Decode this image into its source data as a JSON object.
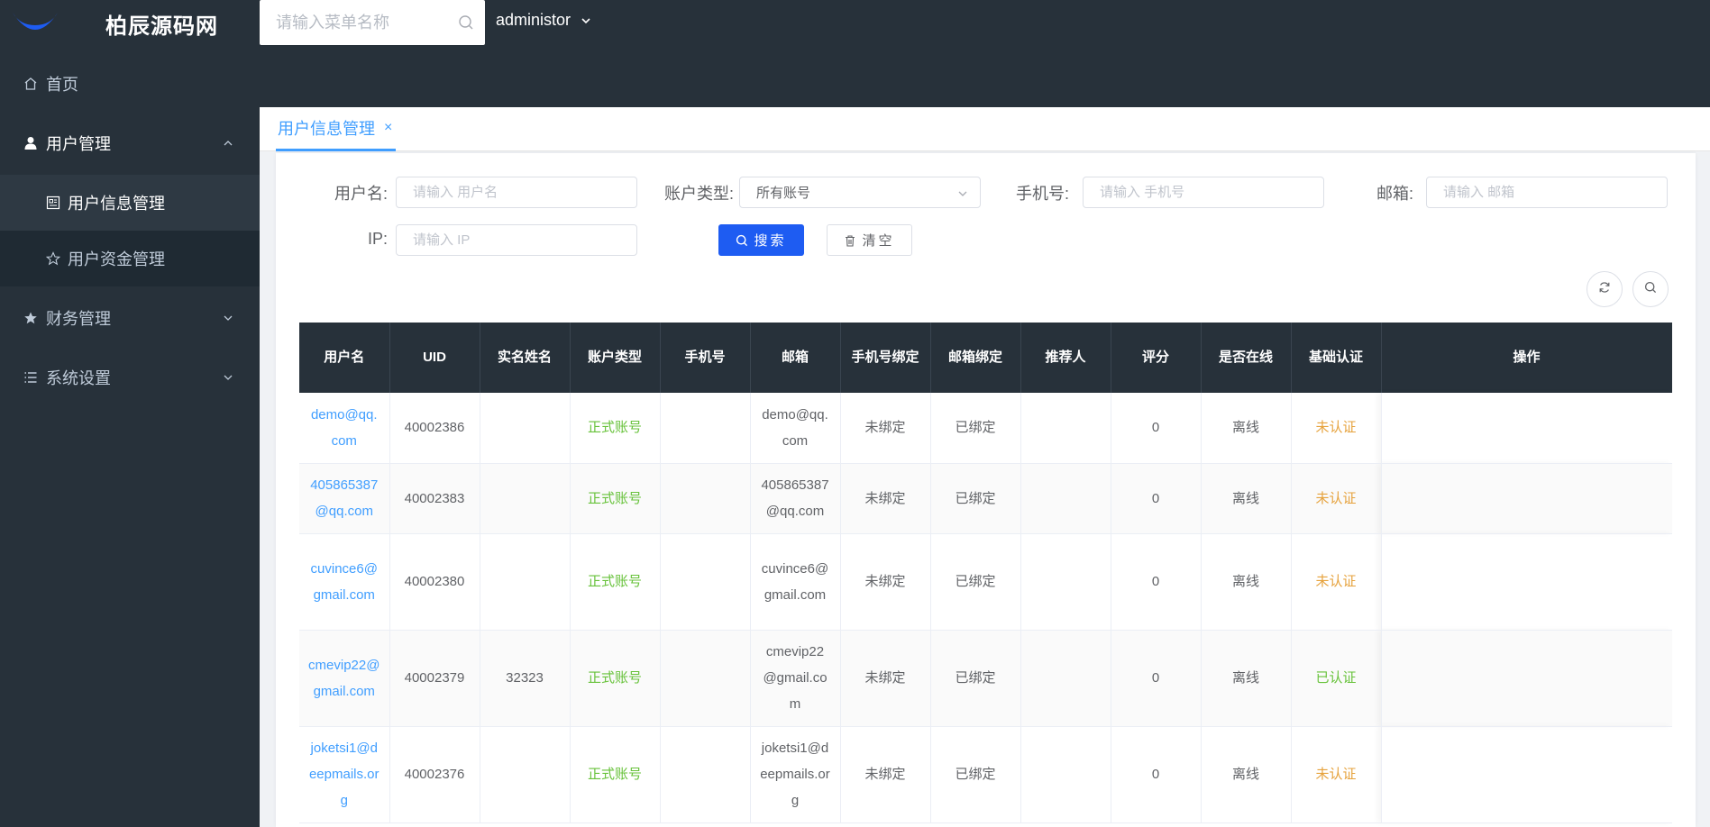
{
  "app": {
    "logo_text": "柏辰源码网"
  },
  "topbar": {
    "search_placeholder": "请输入菜单名称",
    "username": "administor"
  },
  "sidebar": {
    "items": [
      {
        "label": "首页",
        "icon": "home-icon"
      },
      {
        "label": "用户管理",
        "icon": "user-icon",
        "expanded": true,
        "children": [
          {
            "label": "用户信息管理",
            "icon": "profile-card-icon",
            "current": true
          },
          {
            "label": "用户资金管理",
            "icon": "star-outline-icon"
          }
        ]
      },
      {
        "label": "财务管理",
        "icon": "star-filled-icon"
      },
      {
        "label": "系统设置",
        "icon": "list-icon"
      }
    ]
  },
  "tabs": [
    {
      "label": "用户信息管理",
      "close": "×"
    }
  ],
  "filters": {
    "username_label": "用户名:",
    "username_placeholder": "请输入 用户名",
    "account_type_label": "账户类型:",
    "account_type_value": "所有账号",
    "phone_label": "手机号:",
    "phone_placeholder": "请输入 手机号",
    "email_label": "邮箱:",
    "email_placeholder": "请输入 邮箱",
    "ip_label": "IP:",
    "ip_placeholder": "请输入 IP",
    "search_button": "搜索",
    "clear_button": "清空"
  },
  "table": {
    "headers": [
      "用户名",
      "UID",
      "实名姓名",
      "账户类型",
      "手机号",
      "邮箱",
      "手机号绑定",
      "邮箱绑定",
      "推荐人",
      "评分",
      "是否在线",
      "基础认证",
      "操作"
    ],
    "rows": [
      [
        "demo@qq.com",
        "40002386",
        "",
        "正式账号",
        "",
        "demo@qq.com",
        "未绑定",
        "已绑定",
        "",
        "0",
        "离线",
        "未认证",
        ""
      ],
      [
        "405865387@qq.com",
        "40002383",
        "",
        "正式账号",
        "",
        "405865387@qq.com",
        "未绑定",
        "已绑定",
        "",
        "0",
        "离线",
        "未认证",
        ""
      ],
      [
        "cuvince6@gmail.com",
        "40002380",
        "",
        "正式账号",
        "",
        "cuvince6@gmail.com",
        "未绑定",
        "已绑定",
        "",
        "0",
        "离线",
        "未认证",
        ""
      ],
      [
        "cmevip22@gmail.com",
        "40002379",
        "32323",
        "正式账号",
        "",
        "cmevip22@gmail.com",
        "未绑定",
        "已绑定",
        "",
        "0",
        "离线",
        "已认证",
        ""
      ],
      [
        "joketsi1@deepmails.org",
        "40002376",
        "",
        "正式账号",
        "",
        "joketsi1@deepmails.org",
        "未绑定",
        "已绑定",
        "",
        "0",
        "离线",
        "未认证",
        ""
      ]
    ]
  },
  "colors": {
    "sidebar_bg": "#27313a",
    "primary": "#1e5cf2",
    "link": "#409eff",
    "success": "#67c23a",
    "warning": "#e6a23c"
  }
}
